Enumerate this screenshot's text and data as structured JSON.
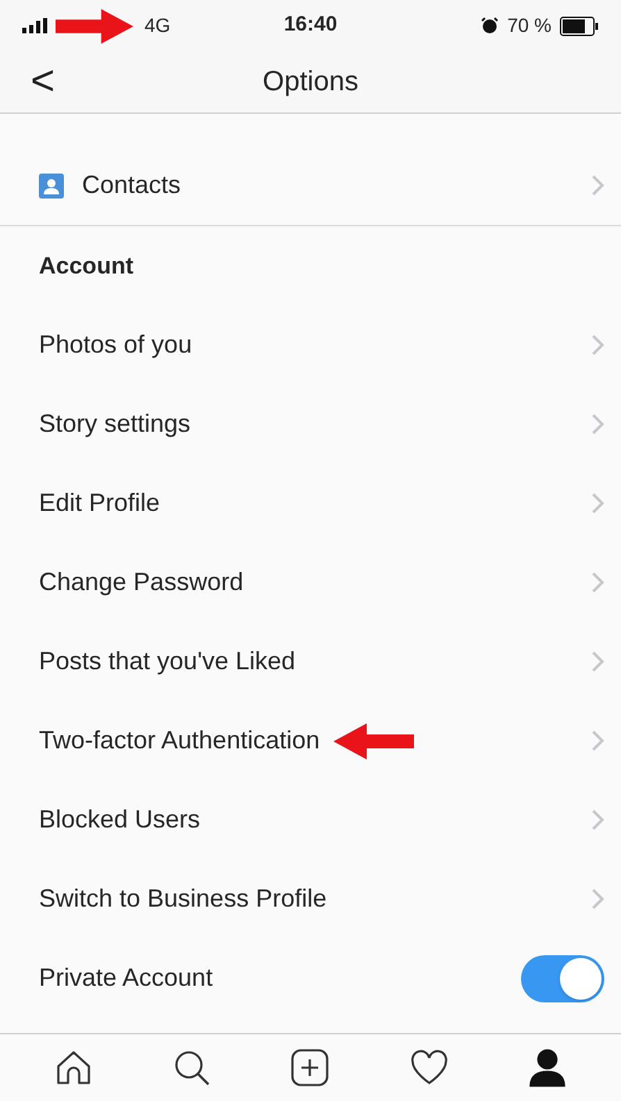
{
  "status_bar": {
    "network": "4G",
    "time": "16:40",
    "battery": "70 %"
  },
  "header": {
    "back": "<",
    "title": "Options"
  },
  "rows": [
    {
      "kind": "contacts",
      "label": "Contacts"
    }
  ],
  "account": {
    "title": "Account",
    "items": [
      {
        "kind": "link",
        "label": "Photos of you"
      },
      {
        "kind": "link",
        "label": "Story settings"
      },
      {
        "kind": "link",
        "label": "Edit Profile"
      },
      {
        "kind": "link",
        "label": "Change Password"
      },
      {
        "kind": "link",
        "label": "Posts that you've Liked"
      },
      {
        "kind": "link",
        "label": "Two-factor Authentication",
        "annotated": true
      },
      {
        "kind": "link",
        "label": "Blocked Users"
      },
      {
        "kind": "link",
        "label": "Switch to Business Profile"
      },
      {
        "kind": "toggle",
        "label": "Private Account",
        "on": true
      }
    ]
  },
  "tab_bar": [
    {
      "kind": "home",
      "selected": false
    },
    {
      "kind": "search",
      "selected": false
    },
    {
      "kind": "add",
      "selected": false
    },
    {
      "kind": "activity",
      "selected": false
    },
    {
      "kind": "profile",
      "selected": true
    }
  ]
}
